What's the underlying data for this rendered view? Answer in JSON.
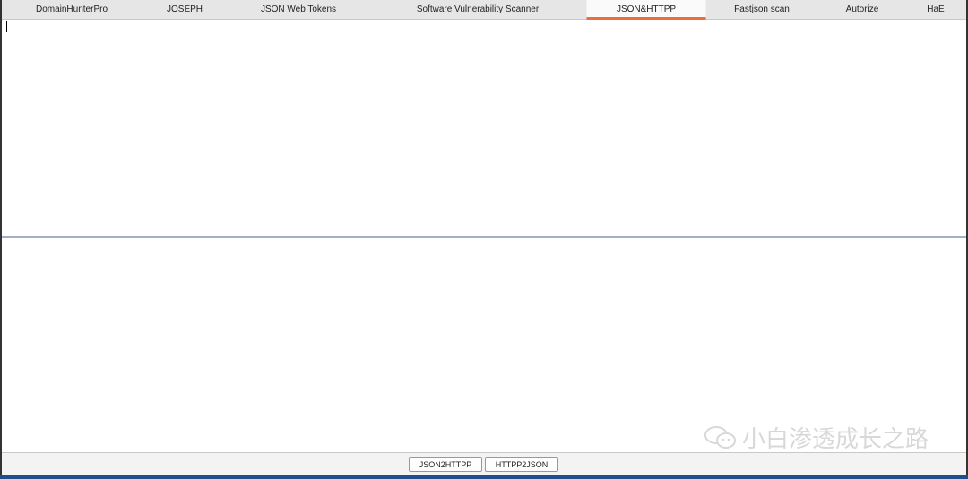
{
  "tabs": [
    {
      "label": "DomainHunterPro",
      "active": false
    },
    {
      "label": "JOSEPH",
      "active": false
    },
    {
      "label": "JSON Web Tokens",
      "active": false
    },
    {
      "label": "Software Vulnerability Scanner",
      "active": false
    },
    {
      "label": "JSON&HTTPP",
      "active": true
    },
    {
      "label": "Fastjson scan",
      "active": false
    },
    {
      "label": "Autorize",
      "active": false
    },
    {
      "label": "HaE",
      "active": false
    }
  ],
  "editors": {
    "top_value": "",
    "bottom_value": ""
  },
  "buttons": {
    "json2http": "JSON2HTTPP",
    "http2json": "HTTPP2JSON"
  },
  "watermark": "小白渗透成长之路",
  "colors": {
    "active_tab_underline": "#f26b3a",
    "status_bar": "#1e4e8c"
  }
}
